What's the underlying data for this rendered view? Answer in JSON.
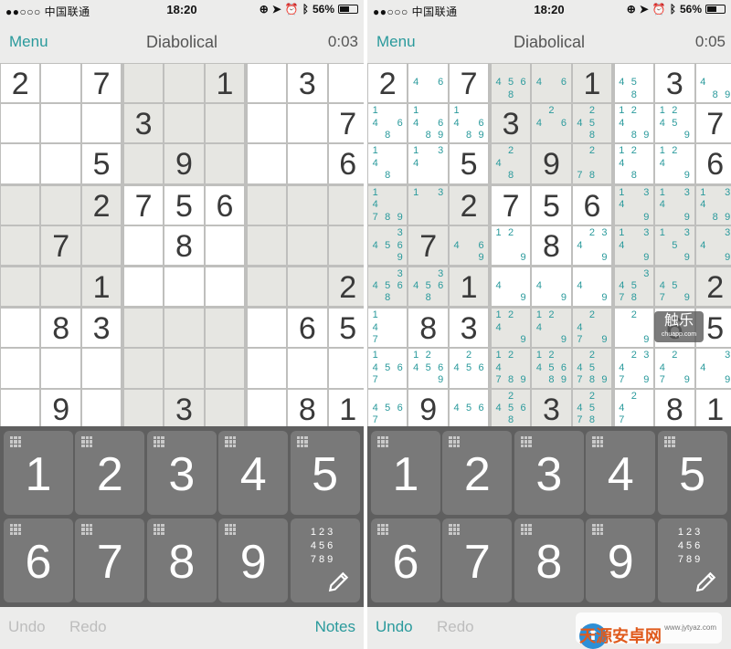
{
  "status": {
    "carrier": "●●○○○ 中国联通",
    "time": "18:20",
    "battery": "56%"
  },
  "screens": [
    {
      "menu": "Menu",
      "title": "Diabolical",
      "timer": "0:03",
      "undo": "Undo",
      "redo": "Redo",
      "notes_label": "Notes"
    },
    {
      "menu": "Menu",
      "title": "Diabolical",
      "timer": "0:05",
      "undo": "Undo",
      "redo": "Redo",
      "notes_label": ""
    }
  ],
  "board": [
    [
      "2",
      "",
      "7",
      "",
      "",
      "1",
      "",
      "3",
      ""
    ],
    [
      "",
      "",
      "",
      "3",
      "",
      "",
      "",
      "",
      "7"
    ],
    [
      "",
      "",
      "5",
      "",
      "9",
      "",
      "",
      "",
      "6"
    ],
    [
      "",
      "",
      "2",
      "7",
      "5",
      "6",
      "",
      "",
      ""
    ],
    [
      "",
      "7",
      "",
      "",
      "8",
      "",
      "",
      "",
      ""
    ],
    [
      "",
      "",
      "1",
      "",
      "",
      "",
      "",
      "",
      "2"
    ],
    [
      "",
      "8",
      "3",
      "",
      "",
      "",
      "",
      "6",
      "5"
    ],
    [
      "",
      "",
      "",
      "",
      "",
      "",
      "",
      "",
      ""
    ],
    [
      "",
      "9",
      "",
      "",
      "3",
      "",
      "",
      "8",
      "1"
    ]
  ],
  "notes": [
    [
      "",
      "46",
      "",
      "4568",
      "46",
      "",
      "458",
      "",
      "489"
    ],
    [
      "1468",
      "14689",
      "14689",
      "",
      "246",
      "2458",
      "12489",
      "12459",
      ""
    ],
    [
      "148",
      "134",
      "",
      "248",
      "",
      "278",
      "1248",
      "1249",
      ""
    ],
    [
      "14789",
      "13",
      "",
      "",
      "",
      "",
      "1349",
      "1349",
      "13489"
    ],
    [
      "34569",
      "",
      "469",
      "129",
      "",
      "2349",
      "1349",
      "1359",
      "349"
    ],
    [
      "34568",
      "34568",
      "",
      "49",
      "49",
      "49",
      "34578",
      "4579",
      ""
    ],
    [
      "147",
      "",
      "",
      "1249",
      "1249",
      "2479",
      "29",
      "",
      ""
    ],
    [
      "14567",
      "124569",
      "2456",
      "124789",
      "1245689",
      "245789",
      "23479",
      "2479",
      "349"
    ],
    [
      "4567",
      "",
      "456",
      "24568",
      "",
      "24578",
      "247",
      "",
      ""
    ]
  ],
  "keypad": {
    "keys": [
      "1",
      "2",
      "3",
      "4",
      "5",
      "6",
      "7",
      "8",
      "9"
    ],
    "notes_grid": "1 2 3 4 5 6 7 8 9",
    "notes_rows": [
      "123",
      "456",
      "789"
    ]
  },
  "watermark": {
    "logo_text": "天源安卓网",
    "url": "www.jytyaz.com",
    "chuapp": "触乐",
    "chuapp_url": "chuapp.com"
  }
}
